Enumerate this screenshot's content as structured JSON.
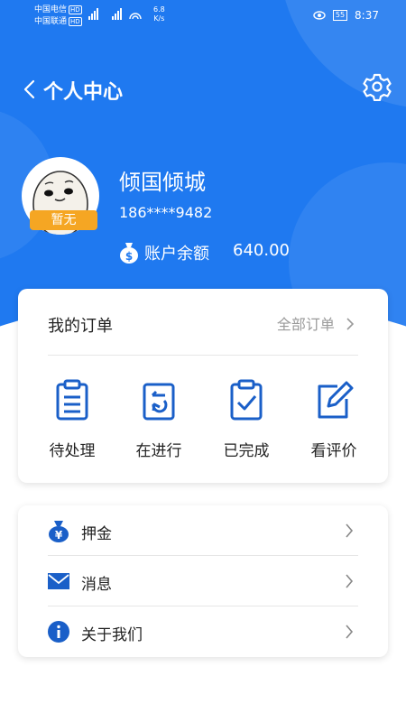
{
  "status_bar": {
    "carrier1": "中国电信",
    "carrier2": "中国联通",
    "hd": "HD",
    "net_speed": "6.8",
    "net_unit": "K/s",
    "battery": "55",
    "time": "8:37"
  },
  "header": {
    "title": "个人中心"
  },
  "profile": {
    "badge": "暂无",
    "name": "倾国倾城",
    "phone": "186****9482",
    "balance_label": "账户余额",
    "balance_value": "640.00"
  },
  "orders": {
    "title": "我的订单",
    "all_label": "全部订单",
    "items": [
      {
        "label": "待处理",
        "icon": "clipboard-list-icon"
      },
      {
        "label": "在进行",
        "icon": "clipboard-refresh-icon"
      },
      {
        "label": "已完成",
        "icon": "clipboard-check-icon"
      },
      {
        "label": "看评价",
        "icon": "edit-pen-icon"
      }
    ]
  },
  "menu": [
    {
      "label": "押金",
      "icon": "money-bag-icon"
    },
    {
      "label": "消息",
      "icon": "mail-icon"
    },
    {
      "label": "关于我们",
      "icon": "info-icon"
    }
  ],
  "colors": {
    "primary": "#1f79f0",
    "icon_blue": "#1a5fc8",
    "badge": "#f5a623"
  }
}
